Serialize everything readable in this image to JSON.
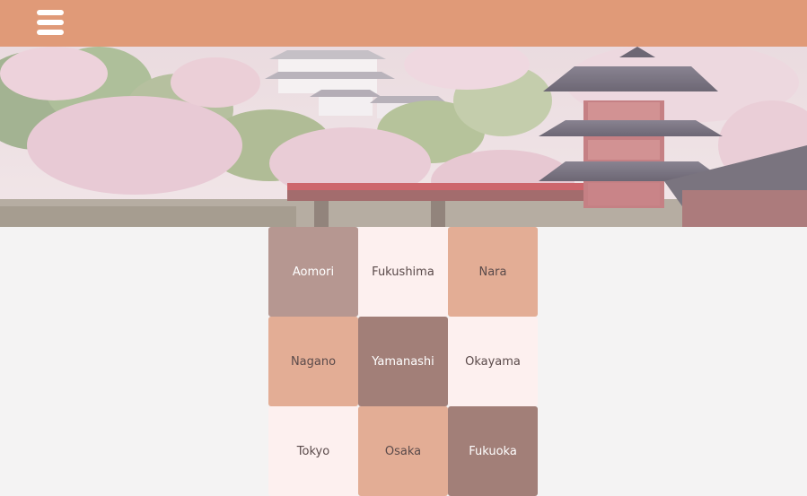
{
  "header": {
    "menu_icon": "hamburger-menu-icon",
    "background_color": "#e09a78"
  },
  "hero": {
    "image_description_icon": "cherry-blossom-banner-image"
  },
  "tiles": [
    {
      "label": "Aomori",
      "bg": "#b69791",
      "fg": "#ffffff"
    },
    {
      "label": "Fukushima",
      "bg": "#fdf0ef",
      "fg": "#5a4a4a"
    },
    {
      "label": "Nara",
      "bg": "#e3ad95",
      "fg": "#5a4a4a"
    },
    {
      "label": "Nagano",
      "bg": "#e3ad95",
      "fg": "#5a4a4a"
    },
    {
      "label": "Yamanashi",
      "bg": "#a27f78",
      "fg": "#ffffff"
    },
    {
      "label": "Okayama",
      "bg": "#fdf0ef",
      "fg": "#5a4a4a"
    },
    {
      "label": "Tokyo",
      "bg": "#fdf0ef",
      "fg": "#5a4a4a"
    },
    {
      "label": "Osaka",
      "bg": "#e3ad95",
      "fg": "#5a4a4a"
    },
    {
      "label": "Fukuoka",
      "bg": "#a27f78",
      "fg": "#ffffff"
    }
  ]
}
